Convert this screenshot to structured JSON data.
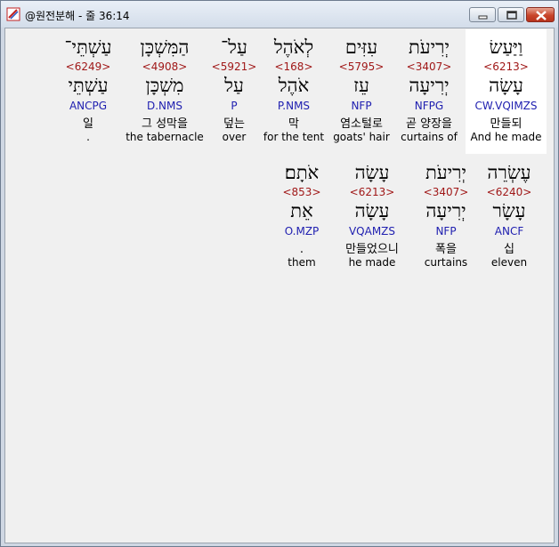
{
  "window": {
    "title": "@원전분해 - 줄 36:14"
  },
  "rows": [
    {
      "words": [
        {
          "hebrew": "וַיַּעַשׂ",
          "strong": "<6213>",
          "lemma": "עָשָׂה",
          "parse": "CW.VQIMZS",
          "korean": "만들되",
          "english": "And he made",
          "highlight": true
        },
        {
          "hebrew": "יְרִיעֹת",
          "strong": "<3407>",
          "lemma": "יְרִיעָה",
          "parse": "NFPG",
          "korean": "곧 양장을",
          "english": "curtains of",
          "highlight": false
        },
        {
          "hebrew": "עִזִּים",
          "strong": "<5795>",
          "lemma": "עֵז",
          "parse": "NFP",
          "korean": "염소털로",
          "english": "goats' hair",
          "highlight": false
        },
        {
          "hebrew": "לְאֹהֶל",
          "strong": "<168>",
          "lemma": "אֹהֶל",
          "parse": "P.NMS",
          "korean": "막",
          "english": "for the tent",
          "highlight": false
        },
        {
          "hebrew": "עַל־",
          "strong": "<5921>",
          "lemma": "עַל",
          "parse": "P",
          "korean": "덮는",
          "english": "over",
          "highlight": false
        },
        {
          "hebrew": "הַמִּשְׁכָּן",
          "strong": "<4908>",
          "lemma": "מִשְׁכָּן",
          "parse": "D.NMS",
          "korean": "그 성막을",
          "english": "the tabernacle",
          "highlight": false
        },
        {
          "hebrew": "עַשְׁתֵּי־",
          "strong": "<6249>",
          "lemma": "עַשְׁתֵּי",
          "parse": "ANCPG",
          "korean": "일",
          "english": ".",
          "highlight": false
        }
      ]
    },
    {
      "words": [
        {
          "hebrew": "עֶשְׂרֵה",
          "strong": "<6240>",
          "lemma": "עָשָׂר",
          "parse": "ANCF",
          "korean": "십",
          "english": "eleven",
          "highlight": false
        },
        {
          "hebrew": "יְרִיעֹת",
          "strong": "<3407>",
          "lemma": "יְרִיעָה",
          "parse": "NFP",
          "korean": "폭을",
          "english": "curtains",
          "highlight": false
        },
        {
          "hebrew": "עָשָׂה",
          "strong": "<6213>",
          "lemma": "עָשָׂה",
          "parse": "VQAMZS",
          "korean": "만들었으니",
          "english": "he made",
          "highlight": false
        },
        {
          "hebrew": "אֹתָם׃",
          "strong": "<853>",
          "lemma": "אֵת",
          "parse": "O.MZP",
          "korean": ".",
          "english": "them",
          "highlight": false
        }
      ]
    }
  ]
}
